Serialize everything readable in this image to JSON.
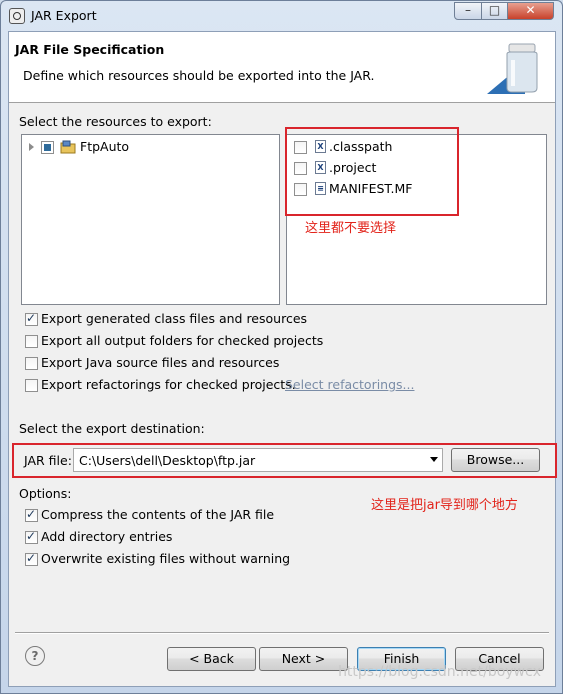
{
  "window": {
    "title": "JAR Export"
  },
  "banner": {
    "title": "JAR File Specification",
    "description": "Define which resources should be exported into the JAR."
  },
  "resources": {
    "label": "Select the resources to export:",
    "tree": [
      {
        "label": "FtpAuto"
      }
    ],
    "files": [
      {
        "label": ".classpath",
        "icon": "xml-file-icon",
        "checked": false
      },
      {
        "label": ".project",
        "icon": "xml-file-icon",
        "checked": false
      },
      {
        "label": "MANIFEST.MF",
        "icon": "text-file-icon",
        "checked": false
      }
    ],
    "note": "这里都不要选择"
  },
  "options_top": [
    {
      "label": "Export generated class files and resources",
      "checked": true
    },
    {
      "label": "Export all output folders for checked projects",
      "checked": false
    },
    {
      "label": "Export Java source files and resources",
      "checked": false
    },
    {
      "label": "Export refactorings for checked projects.",
      "checked": false
    }
  ],
  "select_refactorings_link": "Select refactorings...",
  "destination": {
    "label": "Select the export destination:",
    "jar_label": "JAR file:",
    "jar_value": "C:\\Users\\dell\\Desktop\\ftp.jar",
    "browse": "Browse...",
    "note": "这里是把jar导到哪个地方"
  },
  "options": {
    "label": "Options:",
    "items": [
      {
        "label": "Compress the contents of the JAR file",
        "checked": true
      },
      {
        "label": "Add directory entries",
        "checked": true
      },
      {
        "label": "Overwrite existing files without warning",
        "checked": true
      }
    ]
  },
  "buttons": {
    "help": "?",
    "back": "< Back",
    "next": "Next >",
    "finish": "Finish",
    "cancel": "Cancel"
  },
  "watermark": "https://blog.csdn.net/boywcx"
}
